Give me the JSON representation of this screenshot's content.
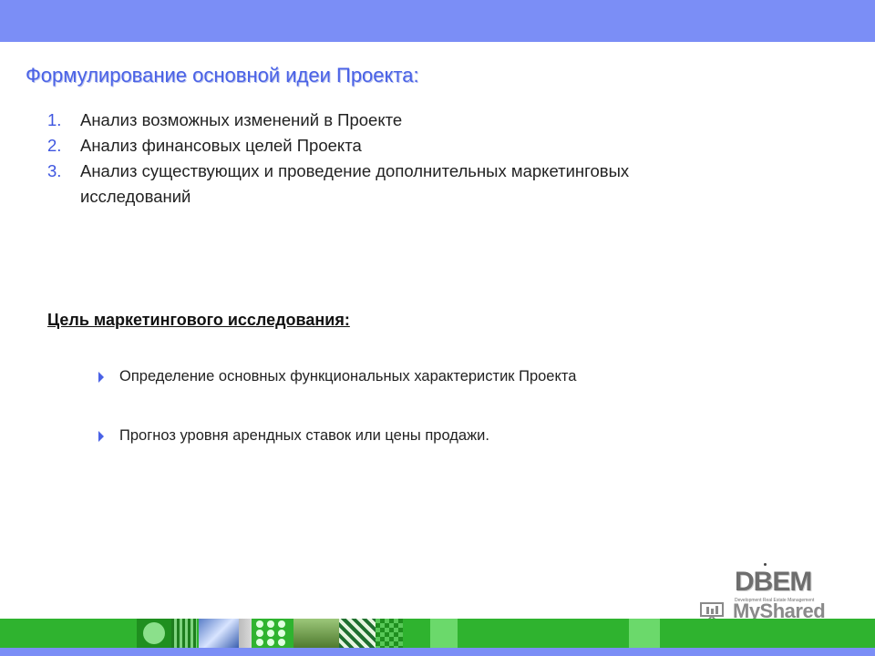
{
  "slide": {
    "title": "Формулирование основной идеи Проекта:",
    "list": [
      {
        "num": "1.",
        "text": "Анализ возможных изменений в Проекте"
      },
      {
        "num": "2.",
        "text": "Анализ финансовых целей Проекта"
      },
      {
        "num": "3.",
        "text": "Анализ существующих и проведение дополнительных маркетинговых исследований"
      }
    ],
    "section_heading": "Цель маркетингового исследования:",
    "bullets": [
      "Определение основных функциональных характеристик Проекта",
      "Прогноз уровня арендных ставок или цены продажи."
    ]
  },
  "logo": {
    "brand": "DBEM",
    "subtitle": "Development Real Estate Management",
    "watermark": "MyShared"
  },
  "colors": {
    "accent_blue": "#7b8ef6",
    "title_blue": "#4a62e6",
    "strip_green": "#2fb32f"
  }
}
